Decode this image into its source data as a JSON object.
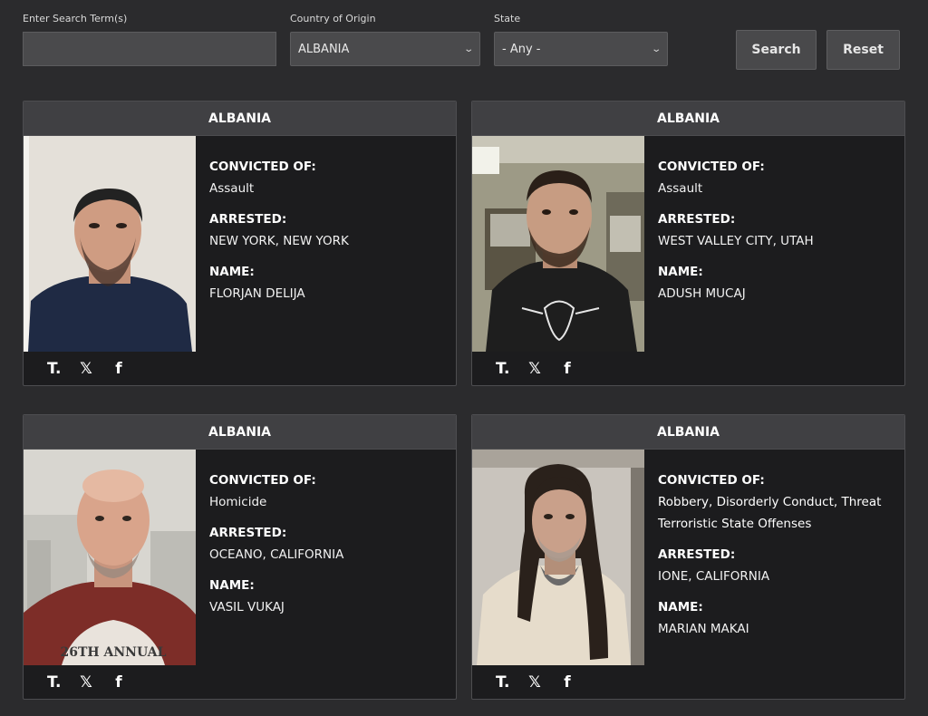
{
  "filters": {
    "search_label": "Enter Search Term(s)",
    "search_value": "",
    "country_label": "Country of Origin",
    "country_value": "ALBANIA",
    "state_label": "State",
    "state_value": "- Any -",
    "search_button": "Search",
    "reset_button": "Reset"
  },
  "labels": {
    "convicted": "CONVICTED OF:",
    "arrested": "ARRESTED:",
    "name": "NAME:"
  },
  "social": {
    "truth_icon": "T.",
    "x_icon": "𝕏",
    "facebook_icon": "f"
  },
  "cards": [
    {
      "country": "ALBANIA",
      "convicted_of": "Assault",
      "convicted_of_2": "",
      "arrested": "NEW YORK, NEW YORK",
      "name": "FLORJAN DELIJA"
    },
    {
      "country": "ALBANIA",
      "convicted_of": "Assault",
      "convicted_of_2": "",
      "arrested": "WEST VALLEY CITY, UTAH",
      "name": "ADUSH MUCAJ"
    },
    {
      "country": "ALBANIA",
      "convicted_of": "Homicide",
      "convicted_of_2": "",
      "arrested": "OCEANO, CALIFORNIA",
      "name": "VASIL VUKAJ"
    },
    {
      "country": "ALBANIA",
      "convicted_of": "Robbery, Disorderly Conduct, Threat",
      "convicted_of_2": "Terroristic State Offenses",
      "arrested": "IONE, CALIFORNIA",
      "name": "MARIAN MAKAI"
    }
  ],
  "photo_shirt_text": "26TH ANNUAL"
}
